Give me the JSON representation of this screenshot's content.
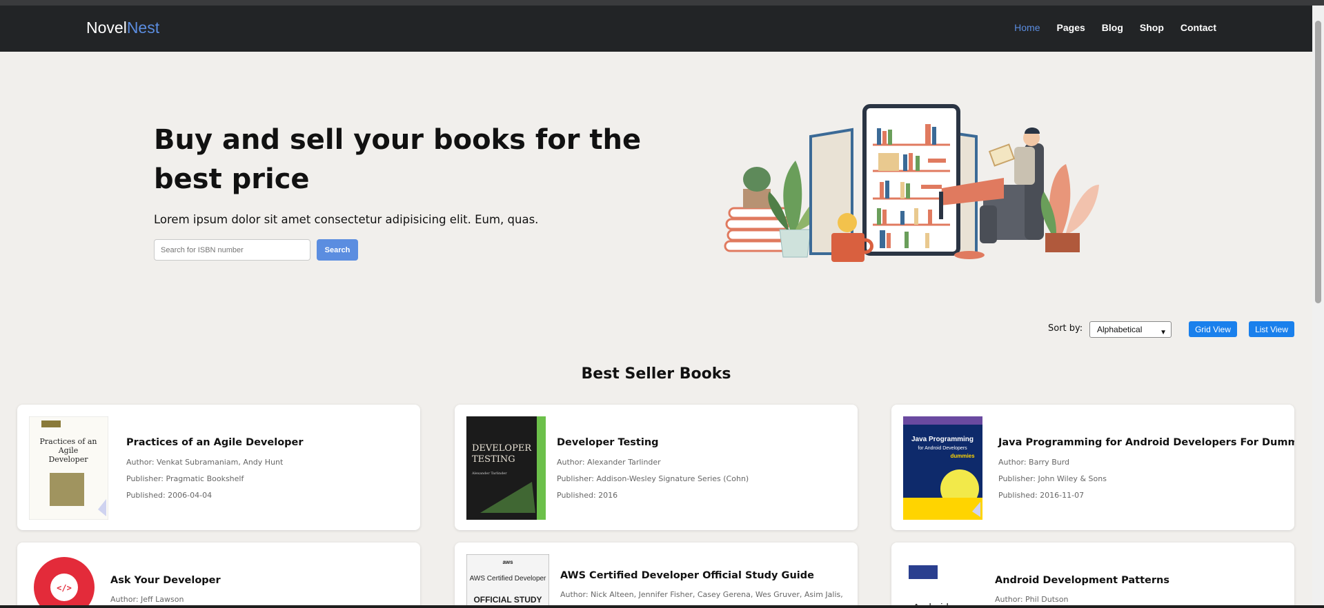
{
  "brand": {
    "part1": "Novel",
    "part2": "Nest"
  },
  "nav": [
    "Home",
    "Pages",
    "Blog",
    "Shop",
    "Contact"
  ],
  "hero": {
    "title": "Buy and sell your books for the best price",
    "subtitle": "Lorem ipsum dolor sit amet consectetur adipisicing elit. Eum, quas.",
    "search_placeholder": "Search for ISBN number",
    "search_button": "Search"
  },
  "controls": {
    "sort_label": "Sort by:",
    "sort_value": "Alphabetical",
    "grid_view": "Grid View",
    "list_view": "List View"
  },
  "section_title": "Best Seller Books",
  "books": [
    {
      "title": "Practices of an Agile Developer",
      "author": "Author: Venkat Subramaniam, Andy Hunt",
      "publisher": "Publisher: Pragmatic Bookshelf",
      "published": "Published: 2006-04-04",
      "cover": {
        "line1": "Practices of an",
        "line2": "Agile",
        "line3": "Developer"
      }
    },
    {
      "title": "Developer Testing",
      "author": "Author: Alexander Tarlinder",
      "publisher": "Publisher: Addison-Wesley Signature Series (Cohn)",
      "published": "Published: 2016",
      "cover": {
        "line1": "DEVELOPER",
        "line2": "TESTING",
        "line3": "Alexander Tarlinder"
      }
    },
    {
      "title": "Java Programming for Android Developers For Dummies",
      "author": "Author: Barry Burd",
      "publisher": "Publisher: John Wiley & Sons",
      "published": "Published: 2016-11-07",
      "cover": {
        "line1": "Java Programming",
        "line2": "for Android Developers",
        "line3": "dummies"
      }
    },
    {
      "title": "Ask Your Developer",
      "author": "Author: Jeff Lawson",
      "publisher": "",
      "published": "",
      "cover": {
        "line1": "</>",
        "line2": "",
        "line3": ""
      }
    },
    {
      "title": "AWS Certified Developer Official Study Guide",
      "author": "Author: Nick Alteen, Jennifer Fisher, Casey Gerena, Wes Gruver, Asim Jalis,",
      "publisher": "",
      "published": "",
      "cover": {
        "line1": "aws",
        "line2": "AWS Certified Developer",
        "line3": "OFFICIAL STUDY"
      }
    },
    {
      "title": "Android Development Patterns",
      "author": "Author: Phil Dutson",
      "publisher": "",
      "published": "",
      "cover": {
        "line1": "Android",
        "line2": "",
        "line3": ""
      }
    }
  ],
  "colors": {
    "accent": "#5b8de0",
    "nav_bg": "#222426",
    "page_bg": "#f1efec",
    "view_btn": "#1a80ec"
  }
}
